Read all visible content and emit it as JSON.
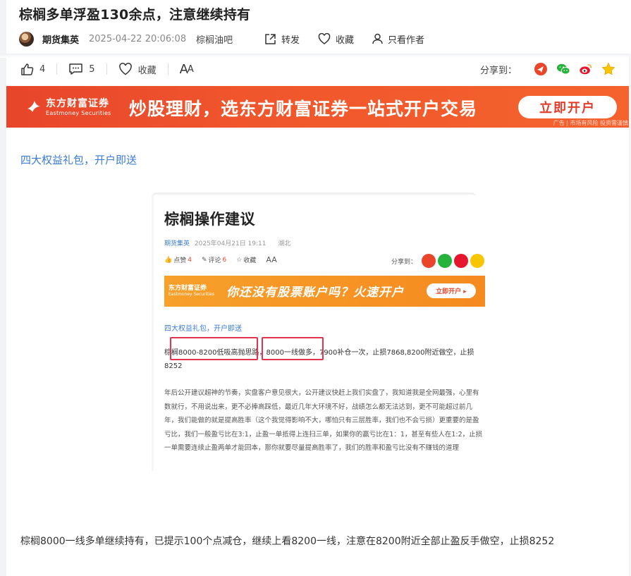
{
  "article": {
    "title": "棕榈多单浮盈130余点，注意继续持有",
    "author": "期货集英",
    "datetime": "2025-04-22 20:06:08",
    "bar_name": "棕榈油吧",
    "actions": {
      "forward": "转发",
      "favorite": "收藏",
      "author_only": "只看作者"
    }
  },
  "toolbar": {
    "likes": "4",
    "comments": "5",
    "favorite": "收藏",
    "font_big": "A",
    "font_small": "A",
    "share_label": "分享到："
  },
  "ad": {
    "brand_cn": "东方财富证券",
    "brand_en": "Eastmoney Securities",
    "slogan": "炒股理财，选东方财富证券一站式开户交易",
    "button": "立即开户",
    "note": "广告 | 市场有风险 投资需谨慎"
  },
  "promo_link": "四大权益礼包，开户即送",
  "embedded": {
    "title": "棕榈操作建议",
    "author": "期货集英",
    "datetime": "2025年04月21日 19:11",
    "location": "湖北",
    "like_label": "点赞",
    "like_count": "4",
    "comment_label": "评论",
    "comment_count": "6",
    "fav_label": "收藏",
    "font_label": "AA",
    "share_label": "分享到：",
    "ad_brand": "东方财富证券",
    "ad_brand_en": "Eastmoney Securities",
    "ad_slogan": "你还没有股票账户吗？火速开户",
    "ad_button": "立即开户 ▸",
    "link": "四大权益礼包，开户即送",
    "para1": "棕榈8000-8200低吸高抛思路，8000一线做多，7900补仓一次，止损7868,8200附近做空，止损8252",
    "para2": "年后公开建议超神的节奏，实盘客户意见很大，公开建议快赶上我们实盘了，我知道我是全网最强，心里有数就行，不用说出来，更不必捧高踩低，最近几年大环境不好，战绩怎么都无法达到，更不可能超过前几年，我们能做的就是提高胜率（这个我觉得影响不大，哪怕只有三层胜率，我们也不会亏损）更重要的是盈亏比，我们一般盈亏比在3:1，止盈一单抵得上连扫三单，如果你的赢亏比在1：1，甚至有些人在1:2，止损一单需要连续止盈两单才能回本，那你就要尽量提高胜率了，我们的胜率和盈亏比没有不赚钱的道理"
  },
  "body_text": "棕榈8000一线多单继续持有，已提示100个点减仓，继续上看8200一线，注意在8200附近全部止盈反手做空，止损8252",
  "colors": {
    "accent": "#e8452b",
    "link": "#3a7bd5",
    "highlight": "#e2344c"
  }
}
